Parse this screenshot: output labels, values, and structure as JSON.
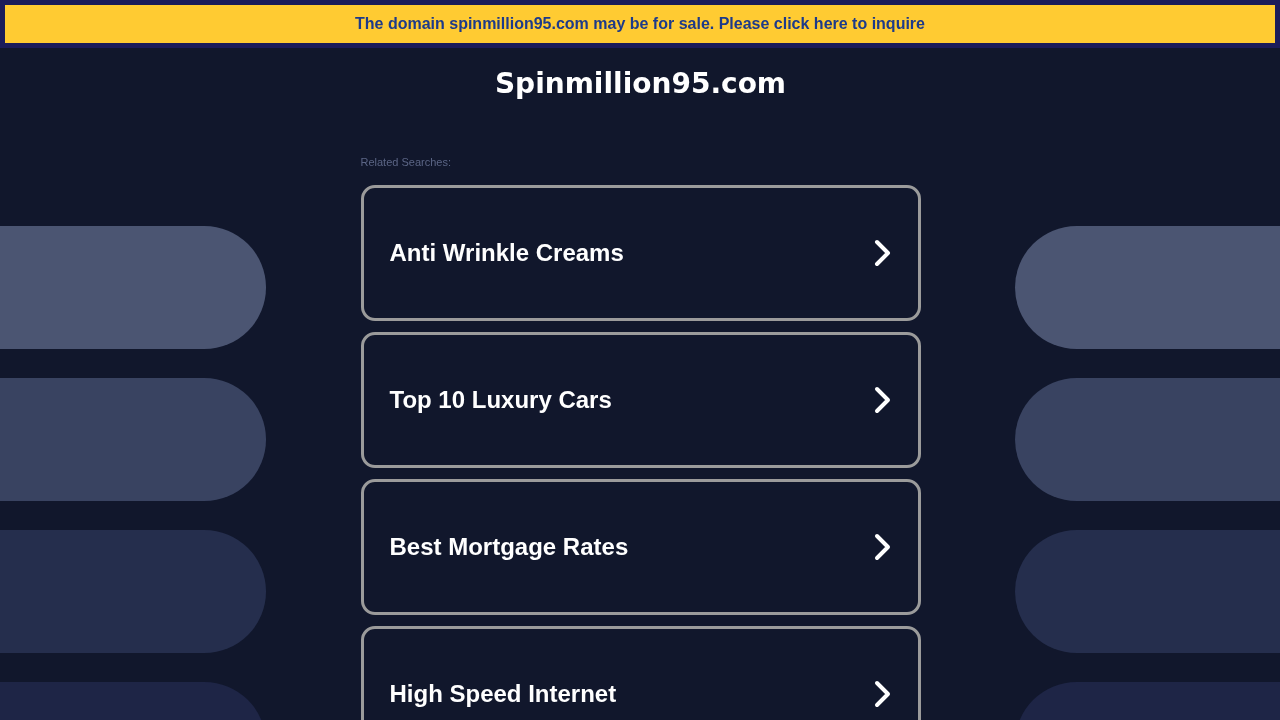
{
  "banner": {
    "text": "The domain spinmillion95.com may be for sale. Please click here to inquire"
  },
  "site_title": "Spinmillion95.com",
  "related_label": "Related Searches:",
  "searches": [
    {
      "label": "Anti Wrinkle Creams"
    },
    {
      "label": "Top 10 Luxury Cars"
    },
    {
      "label": "Best Mortgage Rates"
    },
    {
      "label": "High Speed Internet"
    }
  ]
}
